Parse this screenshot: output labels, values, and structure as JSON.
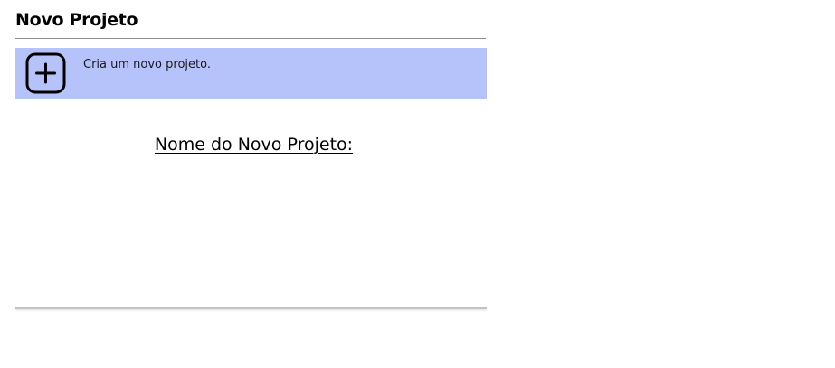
{
  "dialog": {
    "title": "Novo Projeto",
    "banner": {
      "icon": "plus-square-icon",
      "description": "Cria um novo projeto.",
      "background_color": "#b6c3fb"
    },
    "project_name_label": "Nome do Novo Projeto:"
  }
}
